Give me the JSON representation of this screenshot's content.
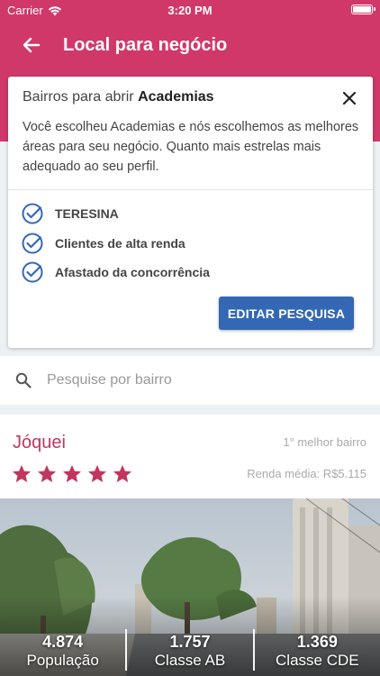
{
  "status_bar": {
    "carrier": "Carrier",
    "time": "3:20 PM"
  },
  "app_bar": {
    "title": "Local para negócio"
  },
  "card": {
    "title_prefix": "Bairros para abrir",
    "title_business": "Academias",
    "description": "Você escolheu Academias e nós escolhemos as melhores áreas para seu negócio. Quanto mais estrelas mais adequado ao seu perfil.",
    "criteria": [
      "TERESINA",
      "Clientes de alta renda",
      "Afastado da concorrência"
    ],
    "edit_button": "EDITAR PESQUISA"
  },
  "search": {
    "placeholder": "Pesquise por bairro"
  },
  "neighborhood": {
    "name": "Jóquei",
    "rank": "1° melhor bairro",
    "rating": 5,
    "rating_max": 5,
    "income": "Renda média: R$5.115",
    "stats": [
      {
        "value": "4.874",
        "label": "População"
      },
      {
        "value": "1.757",
        "label": "Classe AB"
      },
      {
        "value": "1.369",
        "label": "Classe CDE"
      }
    ]
  },
  "colors": {
    "primary": "#d1386a",
    "button": "#3468b4",
    "check": "#3468b4",
    "star": "#c2355f"
  },
  "icons": {
    "back": "arrow-left-icon",
    "close": "close-icon",
    "check": "check-circle-icon",
    "search": "search-icon",
    "star": "star-icon"
  }
}
